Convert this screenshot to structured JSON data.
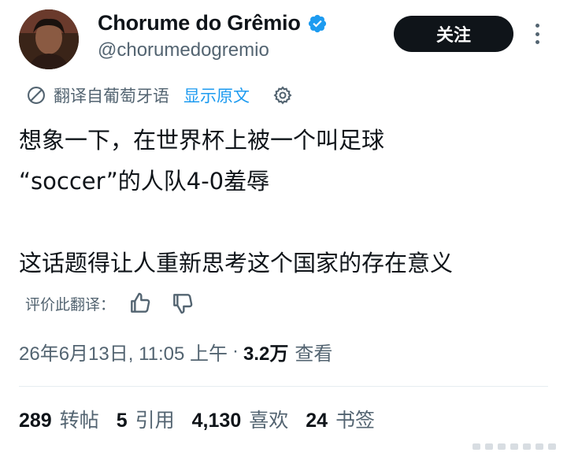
{
  "author": {
    "display_name": "Chorume do Grêmio",
    "handle": "@chorumedogremio",
    "verified_icon": "verified-badge-icon"
  },
  "actions": {
    "follow_label": "关注",
    "more_icon": "more-dots-icon"
  },
  "translation": {
    "label": "翻译自葡萄牙语",
    "show_original": "显示原文",
    "rate_label": "评价此翻译："
  },
  "tweet": {
    "text": "想象一下，在世界杯上被一个叫足球\n“soccer”的人队4-0羞辱\n\n这话题得让人重新思考这个国家的存在意义"
  },
  "meta": {
    "timestamp": "26年6月13日, 11:05 上午",
    "separator": "·",
    "views": "3.2万",
    "views_label": "查看"
  },
  "stats": [
    {
      "count": "289",
      "label": "转帖"
    },
    {
      "count": "5",
      "label": "引用"
    },
    {
      "count": "4,130",
      "label": "喜欢"
    },
    {
      "count": "24",
      "label": "书签"
    }
  ],
  "colors": {
    "text": "#0f1419",
    "secondary": "#536471",
    "link": "#1d9bf0",
    "verified": "#1d9bf0"
  }
}
